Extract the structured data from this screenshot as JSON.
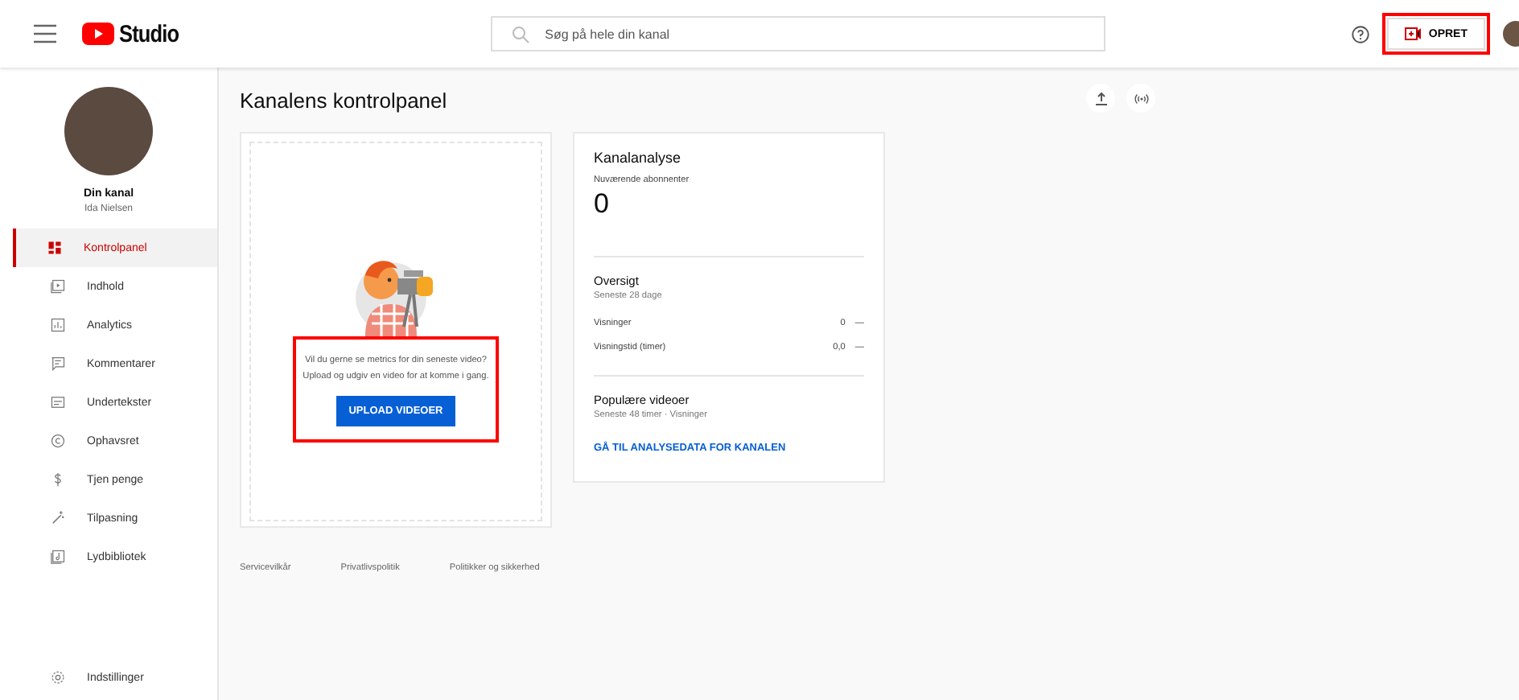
{
  "header": {
    "logo_text": "Studio",
    "search": {
      "placeholder": "Søg på hele din kanal"
    },
    "create_button": "OPRET"
  },
  "channel": {
    "name": "Din kanal",
    "owner": "Ida Nielsen"
  },
  "sidebar": {
    "items": [
      {
        "label": "Kontrolpanel",
        "selected": true
      },
      {
        "label": "Indhold",
        "selected": false
      },
      {
        "label": "Analytics",
        "selected": false
      },
      {
        "label": "Kommentarer",
        "selected": false
      },
      {
        "label": "Undertekster",
        "selected": false
      },
      {
        "label": "Ophavsret",
        "selected": false
      },
      {
        "label": "Tjen penge",
        "selected": false
      },
      {
        "label": "Tilpasning",
        "selected": false
      },
      {
        "label": "Lydbibliotek",
        "selected": false
      }
    ],
    "settings": "Indstillinger"
  },
  "page_title": "Kanalens kontrolpanel",
  "upload_card": {
    "prompt_lines": [
      "Vil du gerne se metrics for din seneste video?",
      "Upload og udgiv en video for at komme i gang."
    ],
    "button": "UPLOAD VIDEOER"
  },
  "analytics_card": {
    "title": "Kanalanalyse",
    "subscribers_label": "Nuværende abonnenter",
    "subscribers": "0",
    "overview": {
      "title": "Oversigt",
      "subtitle": "Seneste 28 dage",
      "rows": [
        {
          "label": "Visninger",
          "value": "0",
          "trend": "—"
        },
        {
          "label": "Visningstid (timer)",
          "value": "0,0",
          "trend": "—"
        }
      ]
    },
    "popular": {
      "title": "Populære videoer",
      "subtitle": "Seneste 48 timer · Visninger"
    },
    "link": "GÅ TIL ANALYSEDATA FOR KANALEN"
  },
  "footer": {
    "links": [
      "Servicevilkår",
      "Privatlivspolitik",
      "Politikker og sikkerhed"
    ]
  }
}
